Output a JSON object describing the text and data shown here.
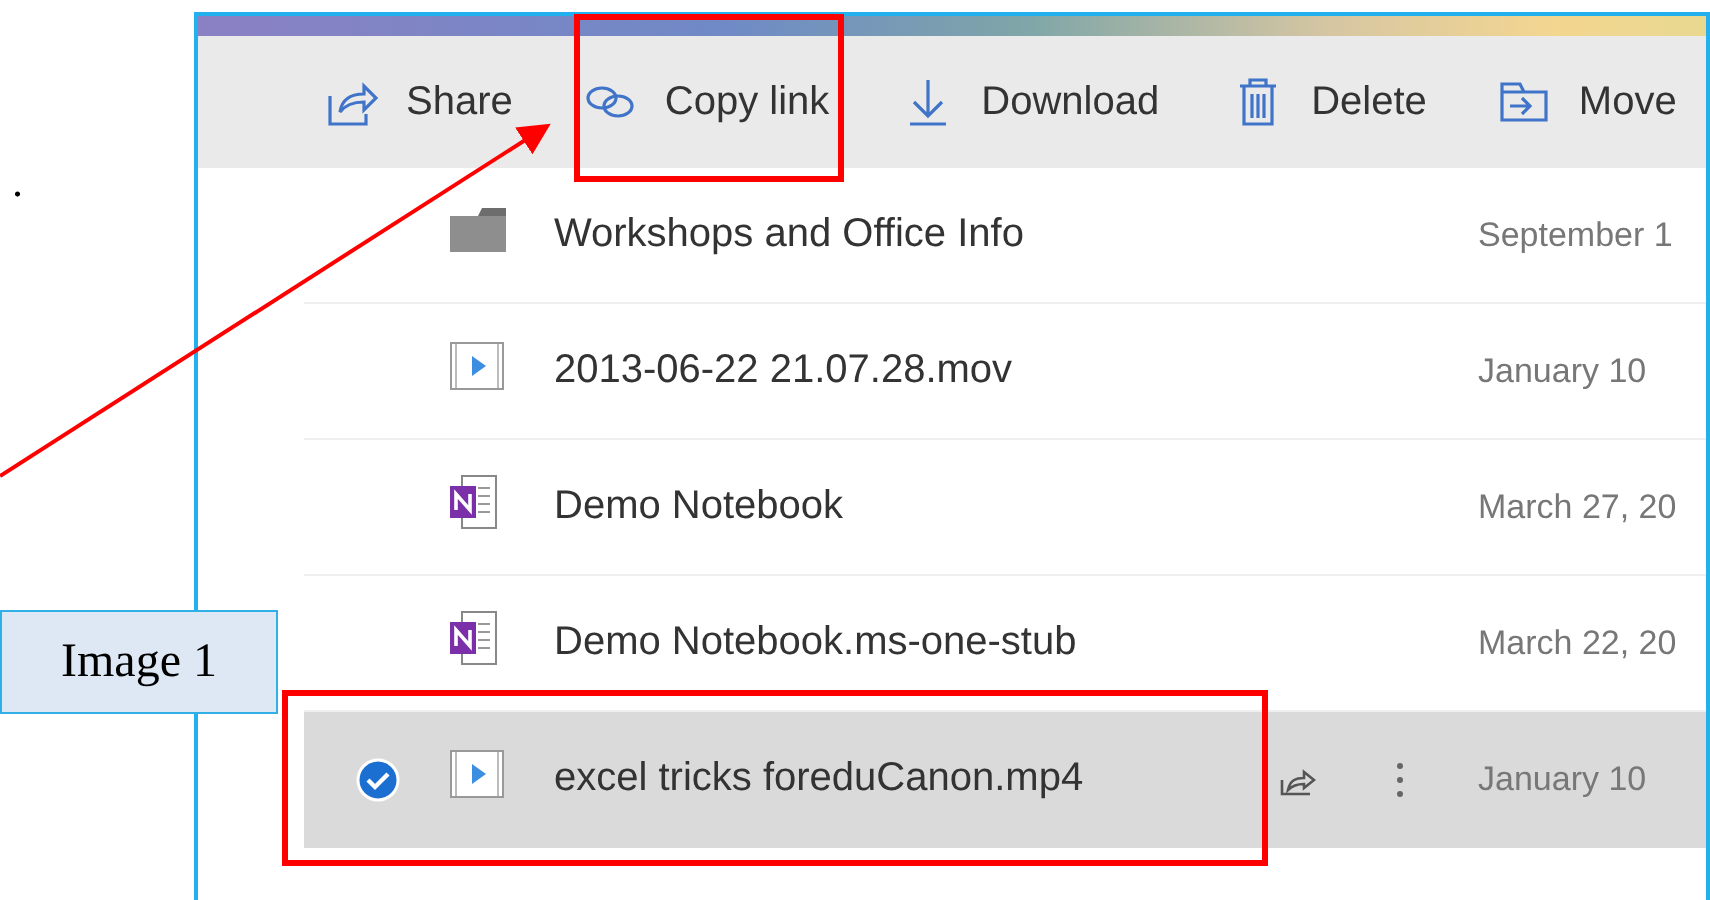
{
  "margin_text": ".",
  "toolbar": [
    {
      "label": "Share",
      "kind": "share"
    },
    {
      "label": "Copy link",
      "kind": "link"
    },
    {
      "label": "Download",
      "kind": "download"
    },
    {
      "label": "Delete",
      "kind": "delete"
    },
    {
      "label": "Move",
      "kind": "move"
    }
  ],
  "rows": [
    {
      "name": "Workshops and Office Info",
      "date": "September 1",
      "kind": "folder",
      "selected": false
    },
    {
      "name": "2013-06-22 21.07.28.mov",
      "date": "January 10",
      "kind": "video",
      "selected": false
    },
    {
      "name": "Demo Notebook",
      "date": "March 27, 20",
      "kind": "onenote",
      "selected": false
    },
    {
      "name": "Demo Notebook.ms-one-stub",
      "date": "March 22, 20",
      "kind": "onenote",
      "selected": false
    },
    {
      "name": "excel tricks foreduCanon.mp4",
      "date": "January 10",
      "kind": "video",
      "selected": true
    }
  ],
  "annotation": {
    "label": "Image 1"
  }
}
